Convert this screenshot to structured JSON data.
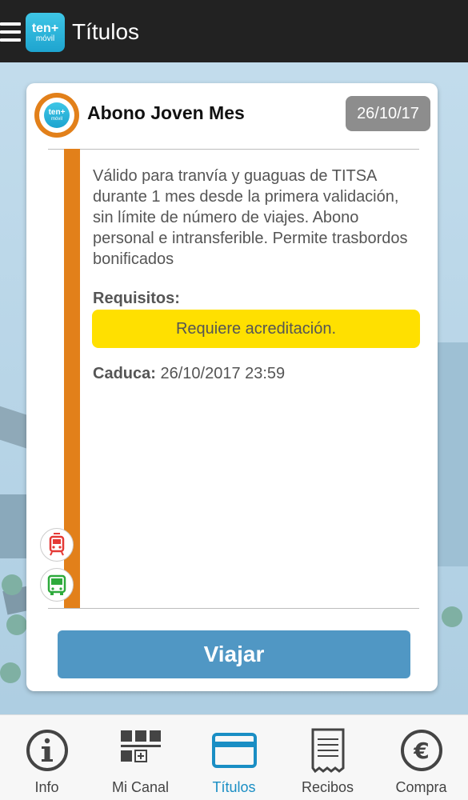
{
  "header": {
    "logo_line1": "ten+",
    "logo_line2": "móvil",
    "title": "Títulos"
  },
  "card": {
    "logo_line1": "ten+",
    "logo_line2": "móvil",
    "title": "Abono Joven Mes",
    "date": "26/10/17",
    "description": "Válido para tranvía y guaguas de TITSA durante 1 mes desde la primera validación, sin límite de número de viajes. Abono personal e intransferible. Permite trasbordos bonificados",
    "requirements_label": "Requisitos:",
    "requirement": "Requiere acreditación.",
    "expiry_label": "Caduca:",
    "expiry_value": "26/10/2017 23:59",
    "button_label": "Viajar",
    "accent_color": "#e2801a",
    "modes": [
      "tram-icon",
      "bus-icon"
    ]
  },
  "nav": {
    "items": [
      {
        "label": "Info",
        "icon": "info-icon"
      },
      {
        "label": "Mi Canal",
        "icon": "grid-icon"
      },
      {
        "label": "Títulos",
        "icon": "card-icon",
        "active": true
      },
      {
        "label": "Recibos",
        "icon": "receipt-icon"
      },
      {
        "label": "Compra",
        "icon": "euro-icon"
      }
    ],
    "active_color": "#1a8ec4"
  }
}
